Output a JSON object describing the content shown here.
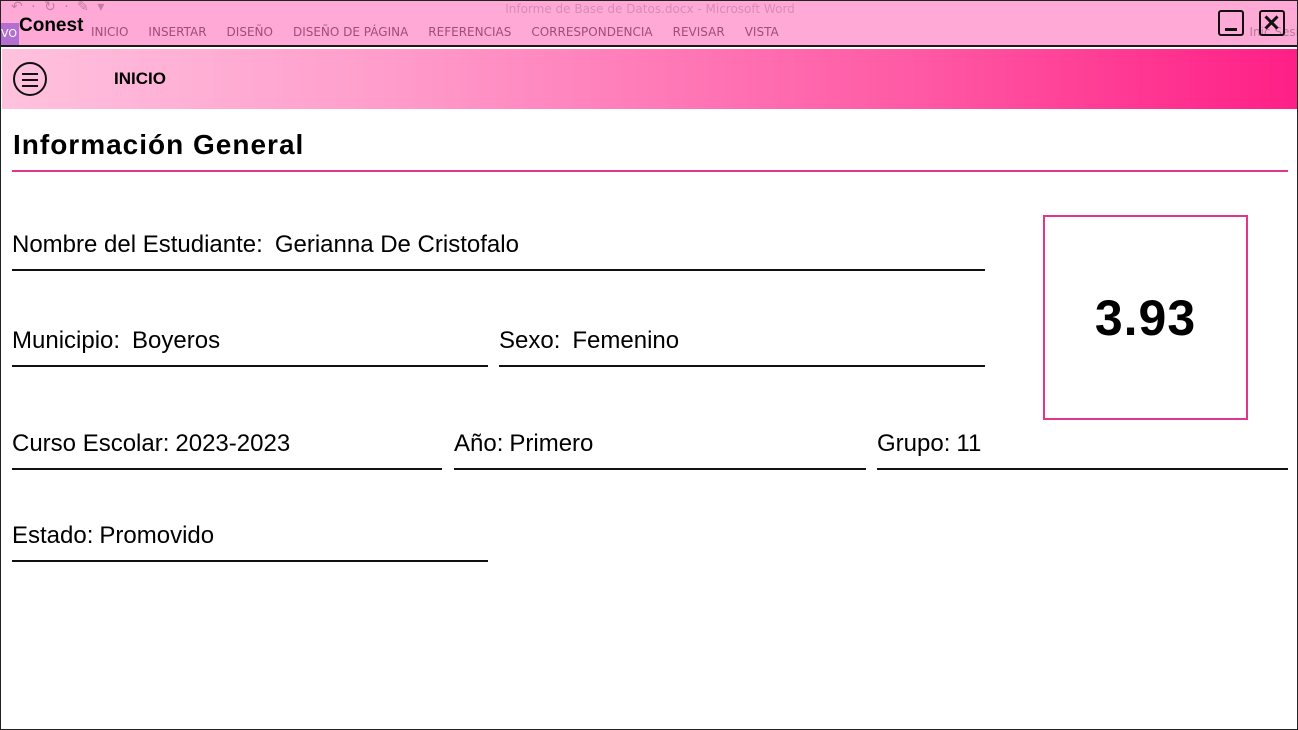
{
  "window": {
    "app_title": "Conest",
    "ghost_title": "Informe de Base de Datos.docx - Microsoft Word",
    "ghost_file_tab": "VO",
    "ghost_tabs": [
      "INICIO",
      "INSERTAR",
      "DISEÑO",
      "DISEÑO DE PÁGINA",
      "REFERENCIAS",
      "CORRESPONDENCIA",
      "REVISAR",
      "VISTA"
    ],
    "ghost_right": "Inic Sesi"
  },
  "navbar": {
    "label": "INICIO"
  },
  "section": {
    "title": "Información General"
  },
  "student": {
    "name_label": "Nombre del Estudiante:",
    "name_value": "Gerianna De Cristofalo",
    "municipio_label": "Municipio:",
    "municipio_value": "Boyeros",
    "sexo_label": "Sexo:",
    "sexo_value": "Femenino",
    "curso_label": "Curso Escolar:",
    "curso_value": "2023-2023",
    "anio_label": "Año:",
    "anio_value": "Primero",
    "grupo_label": "Grupo:",
    "grupo_value": "11",
    "estado_label": "Estado:",
    "estado_value": "Promovido"
  },
  "score": {
    "value": "3.93"
  },
  "colors": {
    "accent": "#e1378a",
    "titlebar": "#ffaad6",
    "nav_gradient_start": "#ffc2de",
    "nav_gradient_end": "#ff1f86"
  }
}
